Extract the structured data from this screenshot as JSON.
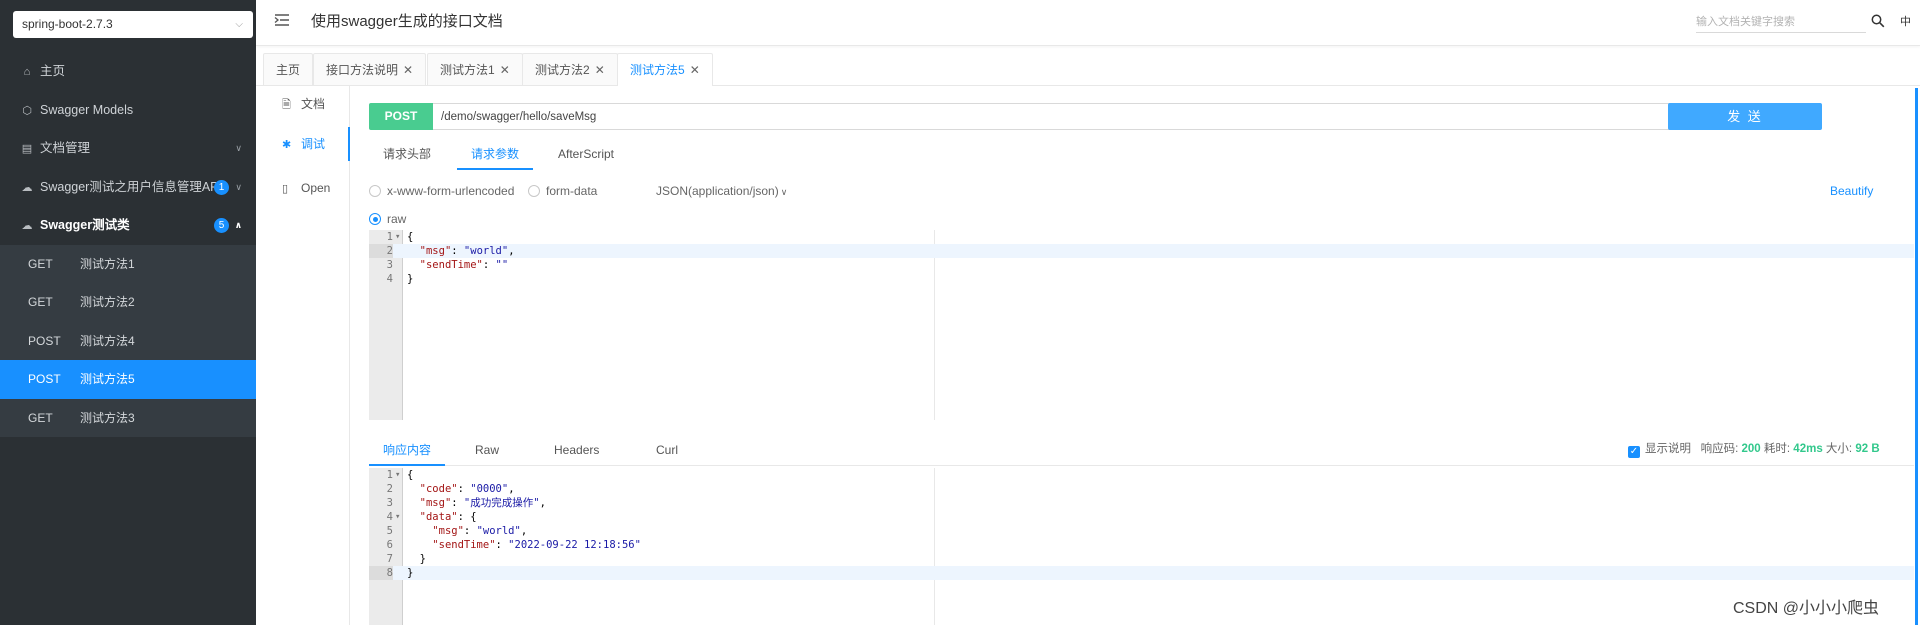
{
  "sidebar": {
    "group_select": "spring-boot-2.7.3",
    "menu": [
      {
        "icon": "home-icon",
        "label": "主页"
      },
      {
        "icon": "cube-icon",
        "label": "Swagger Models"
      },
      {
        "icon": "document-icon",
        "label": "文档管理"
      },
      {
        "icon": "cloud-icon",
        "label": "Swagger测试之用户信息管理API",
        "badge": "1"
      },
      {
        "icon": "cloud-icon",
        "label": "Swagger测试类",
        "badge": "5"
      }
    ],
    "sub_items": [
      {
        "method": "GET",
        "label": "测试方法1"
      },
      {
        "method": "GET",
        "label": "测试方法2"
      },
      {
        "method": "POST",
        "label": "测试方法4"
      },
      {
        "method": "POST",
        "label": "测试方法5"
      },
      {
        "method": "GET",
        "label": "测试方法3"
      }
    ]
  },
  "header": {
    "title": "使用swagger生成的接口文档",
    "search_placeholder": "输入文档关键字搜索",
    "lang": "中"
  },
  "tabs": [
    {
      "label": "主页"
    },
    {
      "label": "接口方法说明"
    },
    {
      "label": "测试方法1"
    },
    {
      "label": "测试方法2"
    },
    {
      "label": "测试方法5"
    }
  ],
  "docnav": {
    "doc": "文档",
    "debug": "调试",
    "open": "Open"
  },
  "request": {
    "method": "POST",
    "url": "/demo/swagger/hello/saveMsg",
    "send": "发 送",
    "subtabs": [
      "请求头部",
      "请求参数",
      "AfterScript"
    ],
    "content_types": [
      "x-www-form-urlencoded",
      "form-data",
      "JSON(application/json)"
    ],
    "raw": "raw",
    "beautify": "Beautify",
    "body_lines": [
      "{",
      "  \"msg\": \"world\",",
      "  \"sendTime\": \"\"",
      "}"
    ]
  },
  "response": {
    "tabs": [
      "响应内容",
      "Raw",
      "Headers",
      "Curl"
    ],
    "show_desc": "显示说明",
    "code_label": "响应码:",
    "code": "200",
    "time_label": "耗时:",
    "time": "42ms",
    "size_label": "大小:",
    "size": "92 B",
    "body_lines": [
      "{",
      "  \"code\": \"0000\",",
      "  \"msg\": \"成功完成操作\",",
      "  \"data\": {",
      "    \"msg\": \"world\",",
      "    \"sendTime\": \"2022-09-22 12:18:56\"",
      "  }",
      "}"
    ]
  },
  "watermark": "CSDN @小小小爬虫",
  "colors": {
    "accent": "#1890ff",
    "post": "#49cc90",
    "sidebar": "#2b3034"
  }
}
